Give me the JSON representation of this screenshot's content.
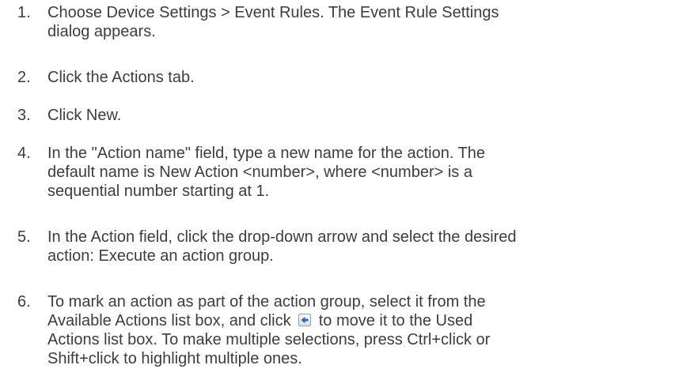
{
  "steps": [
    {
      "number": "1.",
      "lines": [
        "Choose Device Settings > Event Rules. The Event Rule Settings",
        "dialog appears."
      ]
    },
    {
      "number": "2.",
      "lines": [
        "Click the Actions tab."
      ]
    },
    {
      "number": "3.",
      "lines": [
        "Click New."
      ]
    },
    {
      "number": "4.",
      "lines": [
        "In the \"Action name\" field, type a new name for the action. The",
        "default name is New Action <number>, where <number> is a",
        "sequential number starting at 1."
      ]
    },
    {
      "number": "5.",
      "lines": [
        "In the Action field, click the drop-down arrow and select the desired",
        "action: Execute an action group."
      ]
    },
    {
      "number": "6.",
      "lines": [
        "To mark an action as part of the action group, select it from the"
      ],
      "line_with_icon": {
        "before": "Available Actions list box, and click",
        "icon": "move-left-arrow-icon",
        "after": "to move it to the Used"
      },
      "lines_after": [
        "Actions list box. To make multiple selections, press Ctrl+click or",
        "Shift+click to highlight multiple ones."
      ]
    }
  ]
}
